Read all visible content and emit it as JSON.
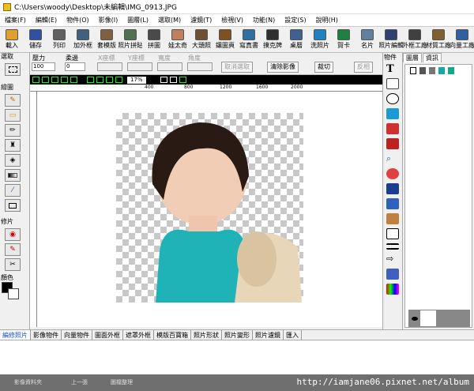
{
  "window": {
    "title": "C:\\Users\\woody\\Desktop\\未編輯\\IMG_0913.JPG"
  },
  "menu": [
    "檔案(F)",
    "編輯(E)",
    "物件(O)",
    "影像(I)",
    "圖層(L)",
    "選取(M)",
    "濾鏡(T)",
    "檢視(V)",
    "功能(N)",
    "設定(S)",
    "說明(H)"
  ],
  "toolbar": [
    {
      "label": "載入",
      "icon": "open-folder-icon",
      "color": "#e0a030"
    },
    {
      "label": "儲存",
      "icon": "save-icon",
      "color": "#3050a0"
    },
    {
      "label": "列印",
      "icon": "printer-icon",
      "color": "#606060"
    },
    {
      "label": "加外框",
      "icon": "frame-icon",
      "color": "#406080"
    },
    {
      "label": "套模版",
      "icon": "template-icon",
      "color": "#806040"
    },
    {
      "label": "照片拼貼",
      "icon": "collage-icon",
      "color": "#507050"
    },
    {
      "label": "拼圖",
      "icon": "puzzle-icon",
      "color": "#4a4a4a"
    },
    {
      "label": "娃太奇",
      "icon": "face-icon",
      "color": "#c08060"
    },
    {
      "label": "大頭照",
      "icon": "portrait-grid-icon",
      "color": "#705030"
    },
    {
      "label": "鑲圖頁",
      "icon": "album-page-icon",
      "color": "#805020"
    },
    {
      "label": "寫真書",
      "icon": "photobook-icon",
      "color": "#3070a0"
    },
    {
      "label": "撲克牌",
      "icon": "poker-icon",
      "color": "#303030"
    },
    {
      "label": "桌曆",
      "icon": "calendar-icon",
      "color": "#406090"
    },
    {
      "label": "洗照片",
      "icon": "print-photo-icon",
      "color": "#2080c0"
    },
    {
      "label": "賀卡",
      "icon": "greeting-card-icon",
      "color": "#208040"
    },
    {
      "label": "名片",
      "icon": "namecard-icon",
      "color": "#6080a0"
    },
    {
      "label": "照片編輯",
      "icon": "photo-edit-icon",
      "color": "#304070"
    },
    {
      "label": "外框工廠",
      "icon": "frame-factory-icon",
      "color": "#404040"
    },
    {
      "label": "材質工廠",
      "icon": "texture-factory-icon",
      "color": "#806030"
    },
    {
      "label": "向量工廠",
      "icon": "vector-factory-icon",
      "color": "#3060a0"
    }
  ],
  "left": {
    "select_title": "選取",
    "draw_title": "繪圖",
    "retouch_title": "修片",
    "color_title": "顏色",
    "foreground_color": "#000000",
    "background_color": "#ffffff"
  },
  "props": {
    "pressure_label": "壓力",
    "pressure_value": "100",
    "feather_label": "柔邊",
    "feather_value": "0",
    "x_label": "X座標",
    "y_label": "Y座標",
    "width_label": "寬度",
    "angle_label": "角度",
    "cancel_select": "取消選取",
    "clear_image": "清除影像",
    "crop": "裁切",
    "invert": "反相"
  },
  "view": {
    "zoom": "17%"
  },
  "ruler": {
    "ticks": [
      "400",
      "800",
      "1200",
      "1600",
      "2000"
    ]
  },
  "objects_panel": {
    "title": "物件"
  },
  "layers_panel": {
    "tabs": [
      "圖層",
      "資訊"
    ]
  },
  "bottom_tabs": [
    "編修照片",
    "影像物件",
    "向量物件",
    "圖面外框",
    "遮罩外框",
    "模版百寶箱",
    "照片形狀",
    "照片變形",
    "照片濾鏡",
    "匯入"
  ],
  "status": {
    "btn1": "影像資料夾",
    "btn2": "上一張",
    "btn3": "圖檔整理",
    "watermark": "http://iamjane06.pixnet.net/album"
  }
}
